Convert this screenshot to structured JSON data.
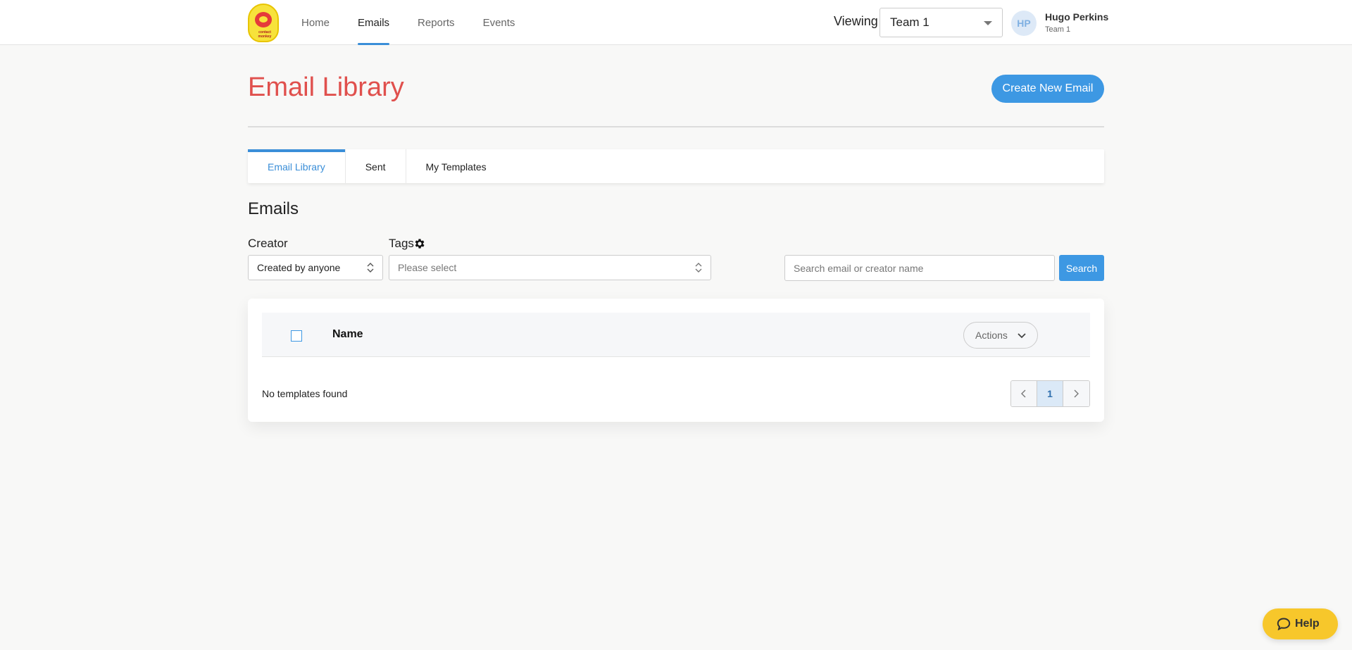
{
  "brand": {
    "logo_text": "contact monkey",
    "accent": "#3d98e3",
    "title_color": "#e0504d"
  },
  "nav": [
    {
      "label": "Home",
      "active": false
    },
    {
      "label": "Emails",
      "active": true
    },
    {
      "label": "Reports",
      "active": false
    },
    {
      "label": "Events",
      "active": false
    }
  ],
  "header": {
    "viewing_label": "Viewing",
    "team_selected": "Team 1",
    "user": {
      "initials": "HP",
      "name": "Hugo Perkins",
      "team": "Team 1"
    }
  },
  "page": {
    "title": "Email Library",
    "create_button": "Create New Email"
  },
  "tabs": [
    {
      "label": "Email Library",
      "active": true
    },
    {
      "label": "Sent",
      "active": false
    },
    {
      "label": "My Templates",
      "active": false
    }
  ],
  "section_title": "Emails",
  "filters": {
    "creator_label": "Creator",
    "creator_value": "Created by anyone",
    "tags_label": "Tags",
    "tags_placeholder": "Please select",
    "search_placeholder": "Search email or creator name",
    "search_button": "Search"
  },
  "table": {
    "column_name": "Name",
    "actions_label": "Actions",
    "empty_message": "No templates found",
    "pagination": {
      "current_page": "1"
    }
  },
  "help": {
    "label": "Help",
    "color": "#f7c72b"
  }
}
